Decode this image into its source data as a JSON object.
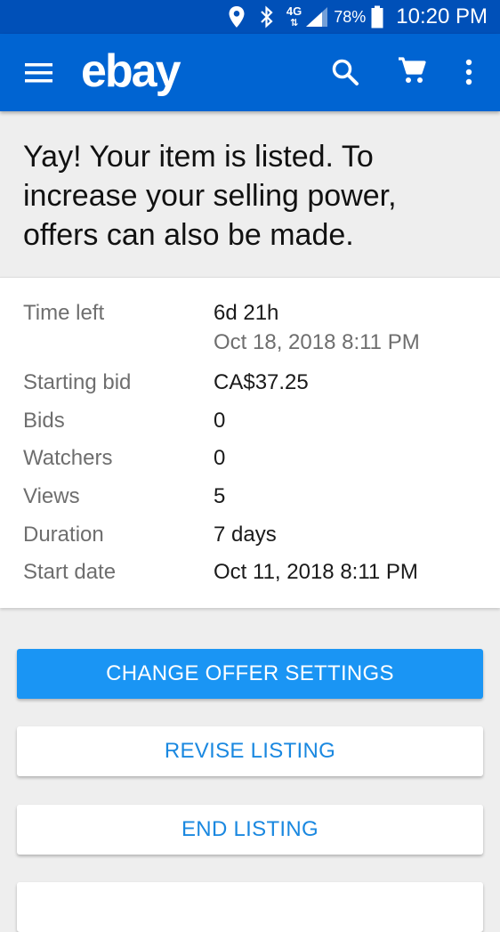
{
  "status_bar": {
    "network": "4G",
    "battery": "78%",
    "time": "10:20 PM"
  },
  "app_bar": {
    "logo": "ebay"
  },
  "headline": "Yay! Your item is listed. To increase your selling power, offers can also be made.",
  "details": {
    "time_left": {
      "label": "Time left",
      "value": "6d 21h",
      "sub": "Oct 18, 2018 8:11 PM"
    },
    "starting_bid": {
      "label": "Starting bid",
      "value": "CA$37.25"
    },
    "bids": {
      "label": "Bids",
      "value": "0"
    },
    "watchers": {
      "label": "Watchers",
      "value": "0"
    },
    "views": {
      "label": "Views",
      "value": "5"
    },
    "duration": {
      "label": "Duration",
      "value": "7 days"
    },
    "start_date": {
      "label": "Start date",
      "value": "Oct 11, 2018 8:11 PM"
    }
  },
  "actions": {
    "change_offer": "CHANGE OFFER SETTINGS",
    "revise": "REVISE LISTING",
    "end": "END LISTING"
  }
}
